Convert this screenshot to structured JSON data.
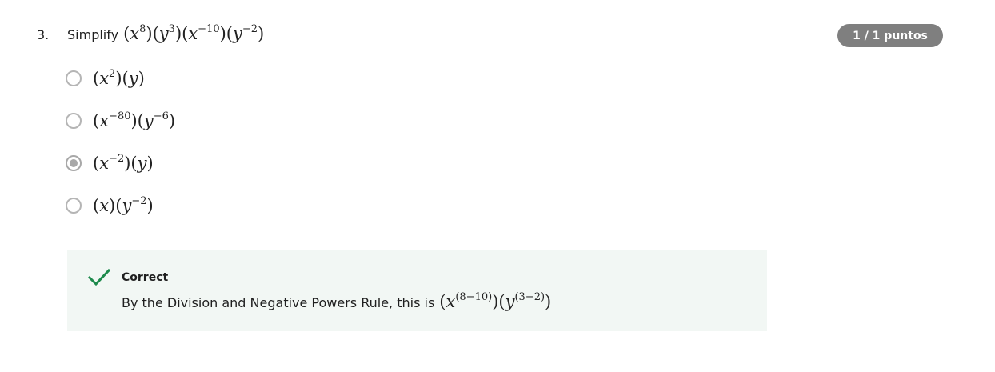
{
  "question": {
    "number": "3.",
    "prompt": "Simplify",
    "expression": {
      "x_exp": "8",
      "y_exp": "3",
      "x_exp2": "−10",
      "y_exp2": "−2"
    }
  },
  "score": {
    "label": "1 / 1 puntos",
    "badge_color": "#7f7f7f"
  },
  "options": [
    {
      "x_exp": "2",
      "y_exp": "",
      "selected": false
    },
    {
      "x_exp": "−80",
      "y_exp": "−6",
      "selected": false
    },
    {
      "x_exp": "−2",
      "y_exp": "",
      "selected": true
    },
    {
      "x_exp": "",
      "y_exp": "−2",
      "selected": false
    }
  ],
  "feedback": {
    "status": "Correct",
    "text": "By the Division and Negative Powers Rule, this is",
    "x_exp": "(8−10)",
    "y_exp": "(3−2)",
    "icon": "check-icon",
    "accent_color": "#1e8a4c",
    "background": "#f2f7f4"
  }
}
